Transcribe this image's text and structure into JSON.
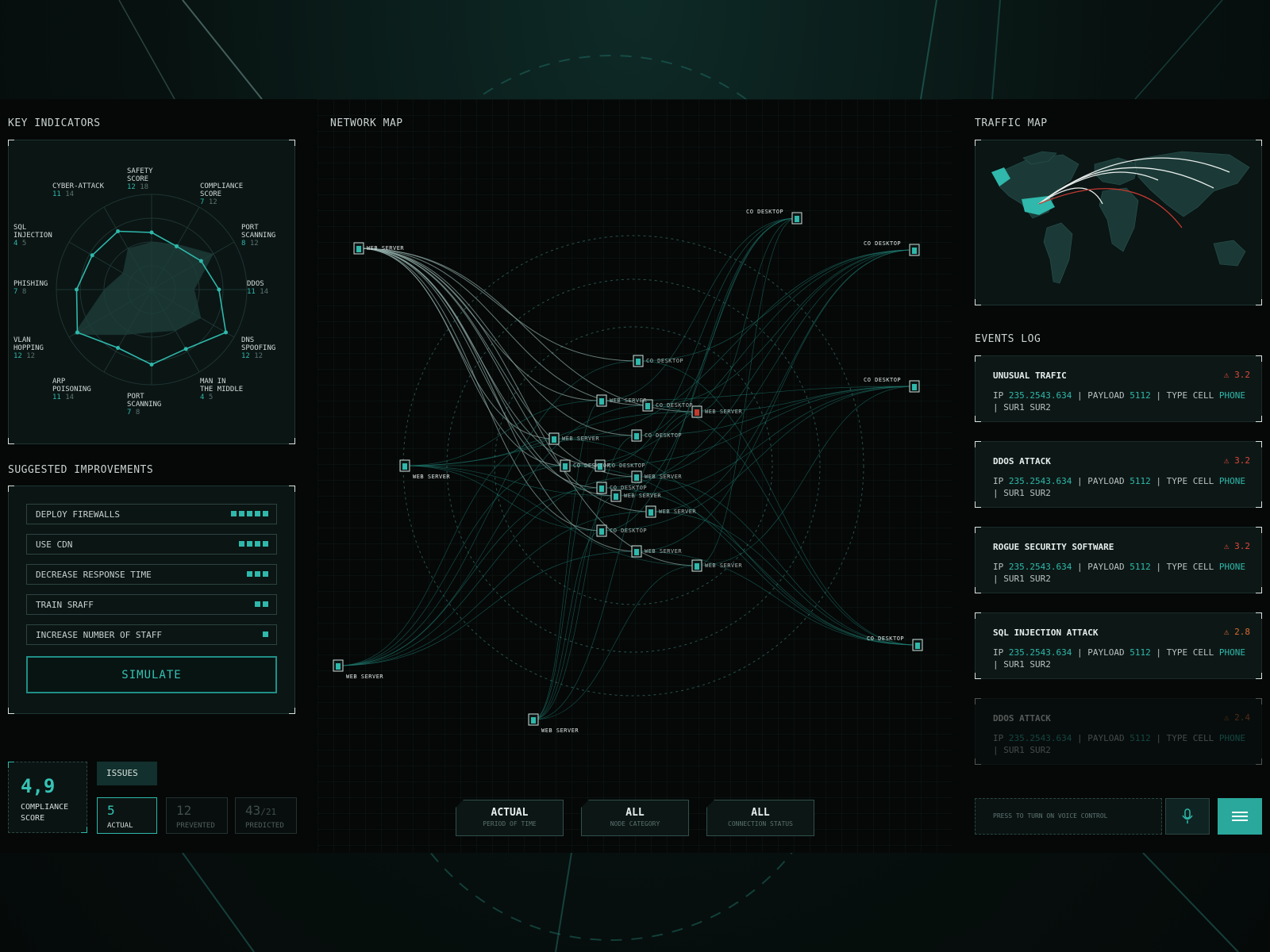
{
  "sections": {
    "key_indicators": "KEY INDICATORS",
    "suggested_improvements": "SUGGESTED IMPROVEMENTS",
    "network_map": "NETWORK MAP",
    "traffic_map": "TRAFFIC MAP",
    "events_log": "EVENTS LOG"
  },
  "radar": {
    "axes": [
      {
        "label": "SAFETY\nSCORE",
        "value": "12",
        "max": "18"
      },
      {
        "label": "COMPLIANCE\nSCORE",
        "value": "7",
        "max": "12"
      },
      {
        "label": "PORT\nSCANNING",
        "value": "8",
        "max": "12"
      },
      {
        "label": "DDOS",
        "value": "11",
        "max": "14"
      },
      {
        "label": "DNS\nSPOOFING",
        "value": "12",
        "max": "12"
      },
      {
        "label": "MAN IN\nTHE MIDDLE",
        "value": "4",
        "max": "5"
      },
      {
        "label": "PORT\nSCANNING",
        "value": "7",
        "max": "8"
      },
      {
        "label": "ARP\nPOISONING",
        "value": "11",
        "max": "14"
      },
      {
        "label": "VLAN\nHOPPING",
        "value": "12",
        "max": "12"
      },
      {
        "label": "PHISHING",
        "value": "7",
        "max": "8"
      },
      {
        "label": "SQL\nINJECTION",
        "value": "4",
        "max": "5"
      },
      {
        "label": "CYBER-ATTACK",
        "value": "11",
        "max": "14"
      }
    ]
  },
  "improvements": [
    {
      "label": "DEPLOY FIREWALLS",
      "level": 5
    },
    {
      "label": "USE CDN",
      "level": 4
    },
    {
      "label": "DECREASE RESPONSE TIME",
      "level": 3
    },
    {
      "label": "TRAIN SRAFF",
      "level": 2
    },
    {
      "label": "INCREASE NUMBER OF STAFF",
      "level": 1
    }
  ],
  "simulate_label": "SIMULATE",
  "compliance": {
    "score": "4,9",
    "label": "COMPLIANCE\nSCORE"
  },
  "issues": {
    "label": "ISSUES",
    "actual": {
      "value": "5",
      "label": "ACTUAL"
    },
    "prevented": {
      "value": "12",
      "label": "PREVENTED"
    },
    "predicted": {
      "value": "43",
      "sub": "/21",
      "label": "PREDICTED"
    }
  },
  "filters": [
    {
      "value": "ACTUAL",
      "label": "PERIOD OF TIME"
    },
    {
      "value": "ALL",
      "label": "NODE CATEGORY"
    },
    {
      "value": "ALL",
      "label": "CONNECTION STATUS"
    }
  ],
  "nodes": [
    {
      "label": "WEB SERVER"
    },
    {
      "label": "CO DESKTOP"
    },
    {
      "label": "CO DESKTOP"
    },
    {
      "label": "CO DESKTOP"
    },
    {
      "label": "CO DESKTOP"
    },
    {
      "label": "WEB SERVER"
    },
    {
      "label": "WEB SERVER"
    },
    {
      "label": "WEB SERVER"
    },
    {
      "label": "CO DESKTOP"
    },
    {
      "label": "WEB SERVER"
    },
    {
      "label": "CO DESKTOP"
    },
    {
      "label": "WEB SERVER"
    },
    {
      "label": "WEB SERVER"
    },
    {
      "label": "CO DESKTOP"
    },
    {
      "label": "CO DESKTOP"
    },
    {
      "label": "CO DESKTOP"
    },
    {
      "label": "WEB SERVER"
    },
    {
      "label": "WEB SERVER"
    },
    {
      "label": "WEB SERVER"
    },
    {
      "label": "CO DESKTOP"
    },
    {
      "label": "WEB SERVER"
    },
    {
      "label": "WEB SERVER"
    },
    {
      "label": "CO DESKTOP"
    }
  ],
  "events": [
    {
      "title": "UNUSUAL TRAFIC",
      "severity": "3.2",
      "ip_label": "IP",
      "ip": "235.2543.634",
      "payload_label": "PAYLOAD",
      "payload": "5112",
      "type_label": "TYPE CELL",
      "type": "PHONE",
      "extra": "| SUR1 SUR2"
    },
    {
      "title": "DDOS ATTACK",
      "severity": "3.2",
      "ip_label": "IP",
      "ip": "235.2543.634",
      "payload_label": "PAYLOAD",
      "payload": "5112",
      "type_label": "TYPE CELL",
      "type": "PHONE",
      "extra": "| SUR1 SUR2"
    },
    {
      "title": "ROGUE SECURITY SOFTWARE",
      "severity": "3.2",
      "ip_label": "IP",
      "ip": "235.2543.634",
      "payload_label": "PAYLOAD",
      "payload": "5112",
      "type_label": "TYPE CELL",
      "type": "PHONE",
      "extra": "| SUR1 SUR2"
    },
    {
      "title": "SQL INJECTION ATTACK",
      "severity": "2.8",
      "ip_label": "IP",
      "ip": "235.2543.634",
      "payload_label": "PAYLOAD",
      "payload": "5112",
      "type_label": "TYPE CELL",
      "type": "PHONE",
      "extra": "| SUR1 SUR2"
    },
    {
      "title": "DDOS ATTACK",
      "severity": "2.4",
      "ip_label": "IP",
      "ip": "235.2543.634",
      "payload_label": "PAYLOAD",
      "payload": "5112",
      "type_label": "TYPE CELL",
      "type": "PHONE",
      "extra": "| SUR1 SUR2"
    }
  ],
  "voice": {
    "placeholder": "PRESS TO TURN ON VOICE CONTROL"
  },
  "colors": {
    "accent": "#2fb8ab",
    "alert": "#e0473b",
    "warning": "#d96a31"
  }
}
